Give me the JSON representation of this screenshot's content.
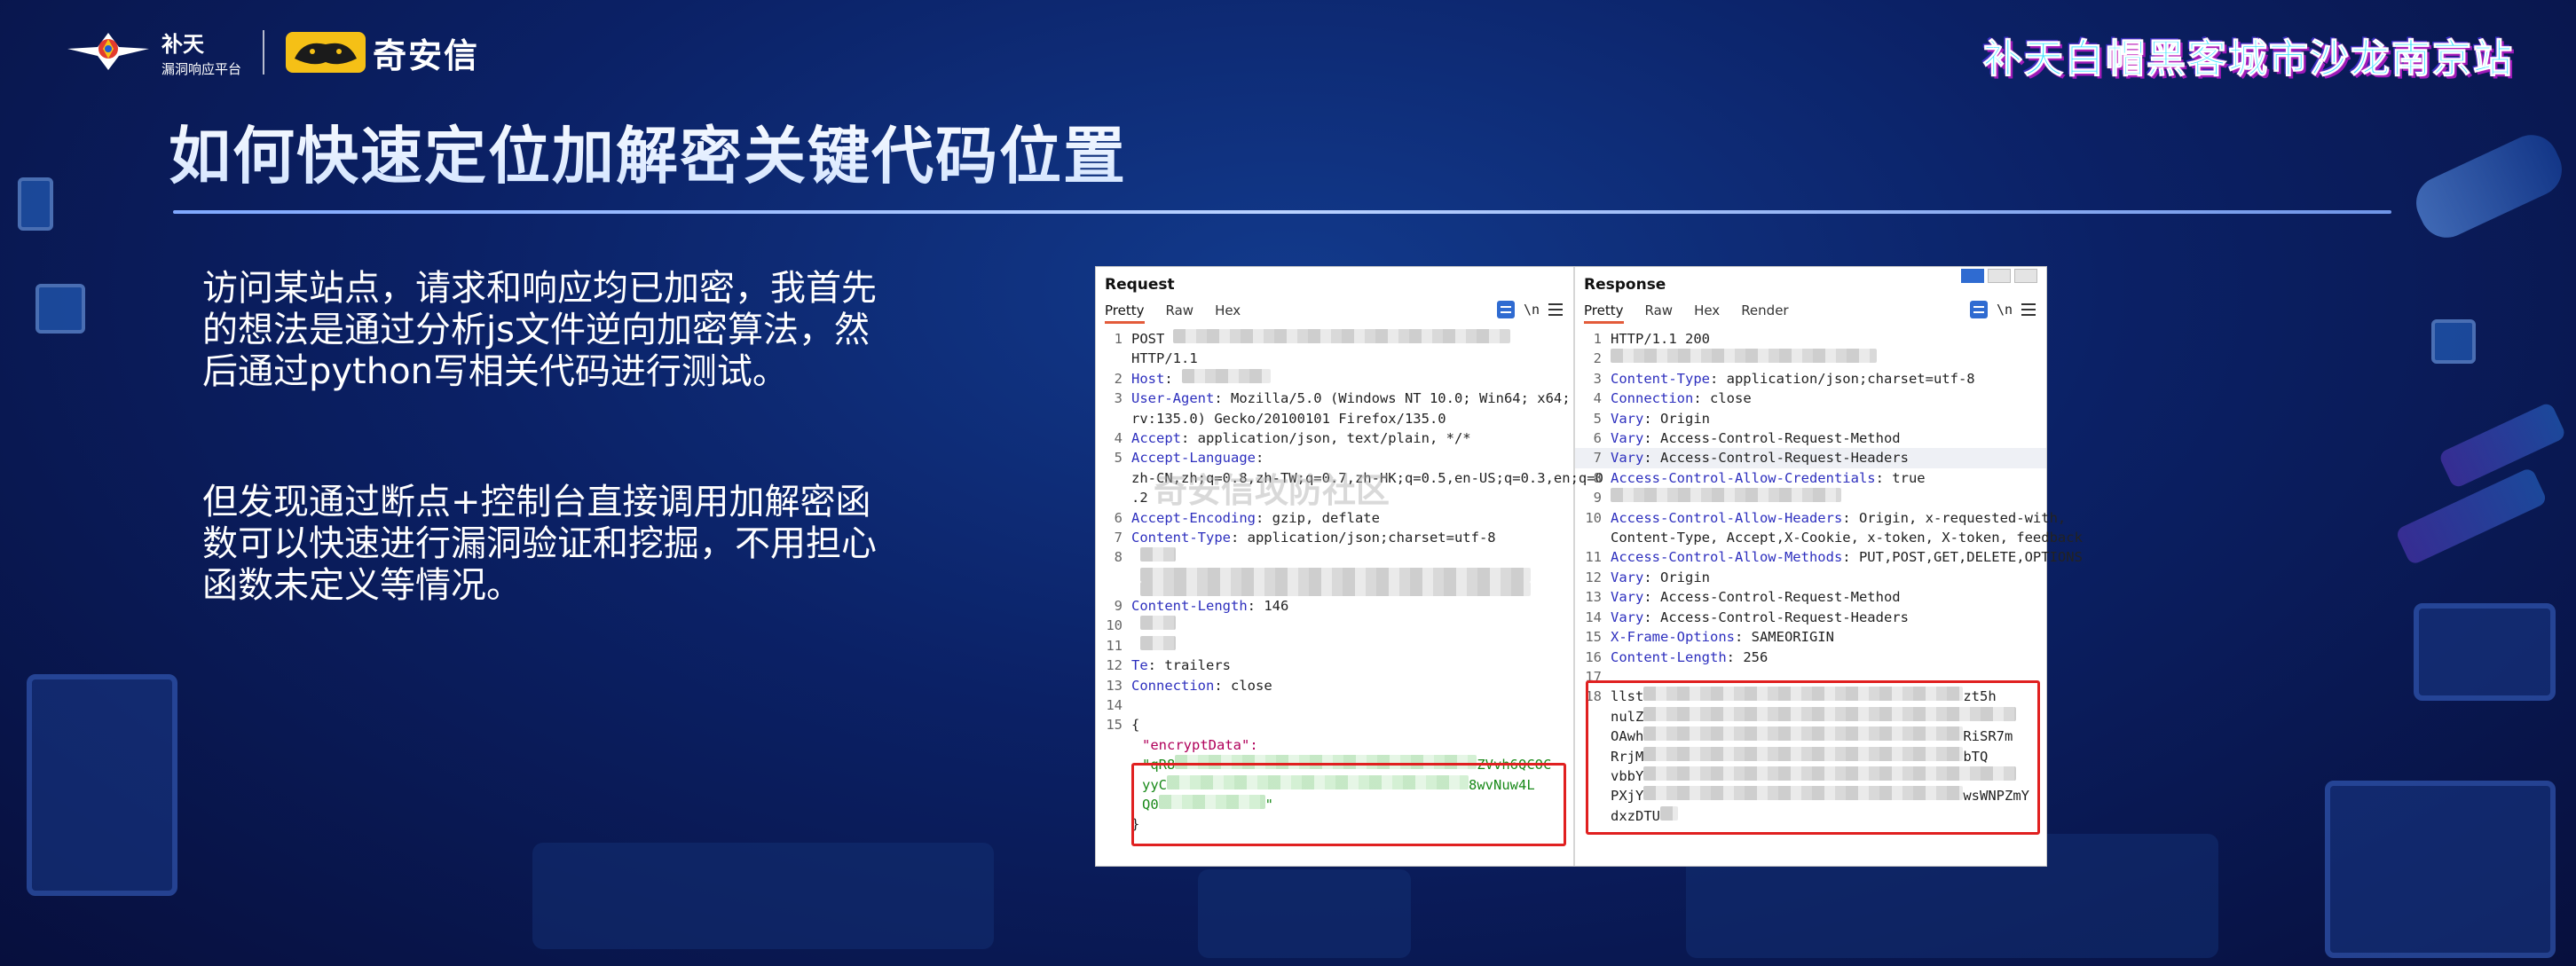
{
  "header": {
    "butian_name": "补天",
    "butian_sub": "漏洞响应平台",
    "qax_name": "奇安信",
    "event_title": "补天白帽黑客城市沙龙南京站"
  },
  "page_title": "如何快速定位加解密关键代码位置",
  "body": {
    "paragraph1": "访问某站点，请求和响应均已加密，我首先的想法是通过分析js文件逆向加密算法，然后通过python写相关代码进行测试。",
    "paragraph2": "但发现通过断点+控制台直接调用加解密函数可以快速进行漏洞验证和挖掘，不用担心函数未定义等情况。"
  },
  "watermark": "奇安信攻防社区",
  "request": {
    "title": "Request",
    "tabs": [
      "Pretty",
      "Raw",
      "Hex"
    ],
    "wrap_toggle": "\\n",
    "lines": [
      {
        "n": "1",
        "k": "",
        "v": "POST"
      },
      {
        "n": "",
        "k": "",
        "v": "HTTP/1.1"
      },
      {
        "n": "2",
        "k": "Host",
        "v": ":"
      },
      {
        "n": "3",
        "k": "User-Agent",
        "v": ": Mozilla/5.0 (Windows NT 10.0; Win64; x64;"
      },
      {
        "n": "",
        "k": "",
        "v": "rv:135.0) Gecko/20100101 Firefox/135.0"
      },
      {
        "n": "4",
        "k": "Accept",
        "v": ": application/json, text/plain, */*"
      },
      {
        "n": "5",
        "k": "Accept-Language",
        "v": ":"
      },
      {
        "n": "",
        "k": "",
        "v": "zh-CN,zh;q=0.8,zh-TW;q=0.7,zh-HK;q=0.5,en-US;q=0.3,en;q=0"
      },
      {
        "n": "",
        "k": "",
        "v": ".2"
      },
      {
        "n": "6",
        "k": "Accept-Encoding",
        "v": ": gzip, deflate"
      },
      {
        "n": "7",
        "k": "Content-Type",
        "v": ": application/json;charset=utf-8"
      },
      {
        "n": "8",
        "k": "",
        "v": ""
      },
      {
        "n": "",
        "k": "",
        "v": ""
      },
      {
        "n": "",
        "k": "",
        "v": ""
      },
      {
        "n": "9",
        "k": "Content-Length",
        "v": ": 146"
      },
      {
        "n": "10",
        "k": "",
        "v": ""
      },
      {
        "n": "11",
        "k": "",
        "v": ""
      },
      {
        "n": "12",
        "k": "Te",
        "v": ": trailers"
      },
      {
        "n": "13",
        "k": "Connection",
        "v": ": close"
      },
      {
        "n": "14",
        "k": "",
        "v": ""
      },
      {
        "n": "15",
        "k": "",
        "v": "{"
      }
    ],
    "json_key": "\"encryptData\":",
    "json_lines": [
      "\"qR8",
      "yyC",
      "Q0"
    ],
    "json_tails": [
      "ZVvh6QCOC",
      "8wvNuw4L",
      "\""
    ],
    "closing_brace": "}"
  },
  "response": {
    "title": "Response",
    "tabs": [
      "Pretty",
      "Raw",
      "Hex",
      "Render"
    ],
    "wrap_toggle": "\\n",
    "lines": [
      {
        "n": "1",
        "k": "",
        "v": "HTTP/1.1 200"
      },
      {
        "n": "2",
        "k": "",
        "v": ""
      },
      {
        "n": "3",
        "k": "Content-Type",
        "v": ": application/json;charset=utf-8"
      },
      {
        "n": "4",
        "k": "Connection",
        "v": ": close"
      },
      {
        "n": "5",
        "k": "Vary",
        "v": ": Origin"
      },
      {
        "n": "6",
        "k": "Vary",
        "v": ": Access-Control-Request-Method"
      },
      {
        "n": "7",
        "k": "Vary",
        "v": ": Access-Control-Request-Headers"
      },
      {
        "n": "8",
        "k": "Access-Control-Allow-Credentials",
        "v": ": true"
      },
      {
        "n": "9",
        "k": "",
        "v": ""
      },
      {
        "n": "10",
        "k": "Access-Control-Allow-Headers",
        "v": ": Origin, x-requested-with,"
      },
      {
        "n": "",
        "k": "",
        "v": "Content-Type, Accept,X-Cookie, x-token, X-token, feedback"
      },
      {
        "n": "11",
        "k": "Access-Control-Allow-Methods",
        "v": ": PUT,POST,GET,DELETE,OPTIONS"
      },
      {
        "n": "12",
        "k": "Vary",
        "v": ": Origin"
      },
      {
        "n": "13",
        "k": "Vary",
        "v": ": Access-Control-Request-Method"
      },
      {
        "n": "14",
        "k": "Vary",
        "v": ": Access-Control-Request-Headers"
      },
      {
        "n": "15",
        "k": "X-Frame-Options",
        "v": ": SAMEORIGIN"
      },
      {
        "n": "16",
        "k": "Content-Length",
        "v": ": 256"
      },
      {
        "n": "17",
        "k": "",
        "v": ""
      }
    ],
    "body_heads": [
      "llst",
      "nulZ",
      "OAwh",
      "RrjM",
      "vbbY",
      "PXjY",
      "dxzDTU"
    ],
    "body_tails": [
      "zt5h",
      "",
      "RiSR7m",
      "bTQ",
      "",
      "wsWNPZmY",
      ""
    ],
    "body_line_no": "18"
  },
  "colors": {
    "header_key": "#2d2fbe",
    "highlight_box": "#e02020",
    "tab_underline": "#e35b3a"
  }
}
